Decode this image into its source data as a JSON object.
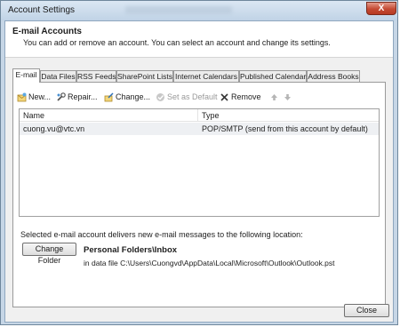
{
  "window": {
    "title": "Account Settings",
    "close_glyph": "X"
  },
  "header": {
    "title": "E-mail Accounts",
    "description": "You can add or remove an account. You can select an account and change its settings."
  },
  "tabs": [
    "E-mail",
    "Data Files",
    "RSS Feeds",
    "SharePoint Lists",
    "Internet Calendars",
    "Published Calendars",
    "Address Books"
  ],
  "toolbar": {
    "new": "New...",
    "repair": "Repair...",
    "change": "Change...",
    "set_default": "Set as Default",
    "remove": "Remove"
  },
  "accounts": {
    "columns": {
      "name": "Name",
      "type": "Type"
    },
    "rows": [
      {
        "name": "cuong.vu@vtc.vn",
        "type": "POP/SMTP (send from this account by default)"
      }
    ]
  },
  "delivery": {
    "text": "Selected e-mail account delivers new e-mail messages to the following location:",
    "change_folder": "Change Folder",
    "folder_path": "Personal Folders\\Inbox",
    "data_file": "in data file C:\\Users\\Cuongvd\\AppData\\Local\\Microsoft\\Outlook\\Outlook.pst"
  },
  "footer": {
    "close": "Close"
  },
  "icons": [
    "new-icon",
    "repair-icon",
    "change-icon",
    "set-default-icon",
    "remove-icon",
    "move-up-icon",
    "move-down-icon",
    "close-window-icon"
  ]
}
